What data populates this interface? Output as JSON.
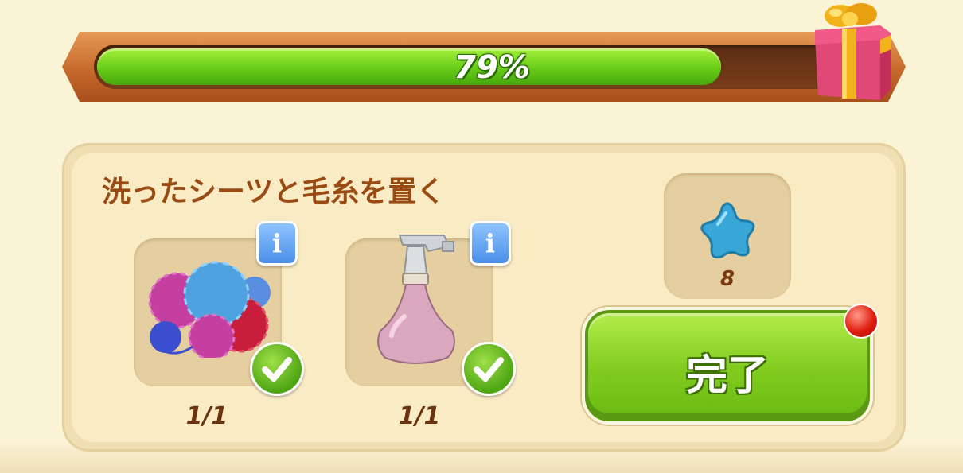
{
  "progress": {
    "value": 0.79,
    "label": "79%"
  },
  "task": {
    "title": "洗ったシーツと毛糸を置く",
    "items": [
      {
        "name": "yarn-balls",
        "icon": "yarn-balls-icon",
        "count": "1/1",
        "completed": true
      },
      {
        "name": "spray-bottle",
        "icon": "spray-bottle-icon",
        "count": "1/1",
        "completed": true
      }
    ],
    "info_label": "i"
  },
  "reward": {
    "icon": "blue-star-icon",
    "amount": "8"
  },
  "complete_button": {
    "label": "完了",
    "notification": true
  },
  "colors": {
    "progress_green": "#6ccf1a",
    "frame_orange": "#c66a2c",
    "title_brown": "#9a4b14",
    "button_green": "#82cc20",
    "star_blue": "#38a6d6"
  }
}
